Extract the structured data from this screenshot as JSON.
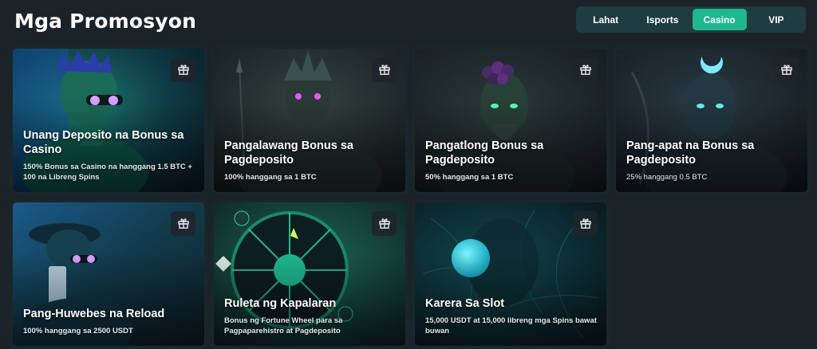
{
  "page": {
    "title": "Mga Promosyon"
  },
  "tabs": [
    {
      "label": "Lahat",
      "active": false
    },
    {
      "label": "Isports",
      "active": false
    },
    {
      "label": "Casino",
      "active": true
    },
    {
      "label": "VIP",
      "active": false
    }
  ],
  "colors": {
    "background": "#1b2329",
    "accent": "#1fb78f",
    "tabs_bg": "#1f3c40"
  },
  "cards": [
    {
      "title": "Unang Deposito na Bonus sa Casino",
      "subtitle": "150% Bonus sa Casino na hanggang 1.5 BTC + 100 na Libreng Spins",
      "icon": "gift-icon"
    },
    {
      "title": "Pangalawang Bonus sa Pagdeposito",
      "subtitle": "100% hanggang sa 1 BTC",
      "icon": "gift-icon"
    },
    {
      "title": "Pangatlong Bonus sa Pagdeposito",
      "subtitle": "50% hanggang sa 1 BTC",
      "icon": "gift-icon"
    },
    {
      "title": "Pang-apat na Bonus sa Pagdeposito",
      "subtitle": "25% hanggang 0.5 BTC",
      "icon": "gift-icon"
    },
    {
      "title": "Pang-Huwebes na Reload",
      "subtitle": "100% hanggang sa 2500 USDT",
      "icon": "gift-icon"
    },
    {
      "title": "Ruleta ng Kapalaran",
      "subtitle": "Bonus ng Fortune Wheel para sa Pagpaparehistro at Pagdeposito",
      "icon": "gift-icon"
    },
    {
      "title": "Karera Sa Slot",
      "subtitle": "15,000 USDT at 15,000 libreng mga Spins bawat buwan",
      "icon": "gift-icon"
    }
  ]
}
